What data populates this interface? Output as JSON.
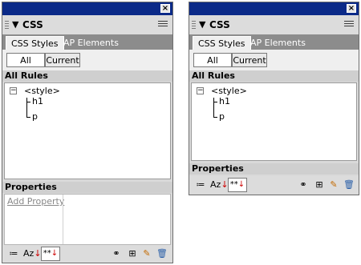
{
  "panels": [
    {
      "title": "CSS",
      "tabs": [
        "CSS Styles",
        "AP Elements"
      ],
      "modes": [
        "All",
        "Current"
      ],
      "rules_label": "All Rules",
      "rules": {
        "root": "<style>",
        "children": [
          "h1",
          "p"
        ]
      },
      "properties_label": "Properties",
      "add_property": "Add Property",
      "toolbar": {
        "az_label": "Az",
        "star_label": "**"
      }
    },
    {
      "title": "CSS",
      "tabs": [
        "CSS Styles",
        "AP Elements"
      ],
      "modes": [
        "All",
        "Current"
      ],
      "rules_label": "All Rules",
      "rules": {
        "root": "<style>",
        "children": [
          "h1",
          "p"
        ]
      },
      "properties_label": "Properties",
      "toolbar": {
        "az_label": "Az",
        "star_label": "**"
      }
    }
  ],
  "icons": [
    "close-icon",
    "gripper-icon",
    "collapse-arrow-icon",
    "options-menu-icon",
    "collapse-tree-icon",
    "category-view-icon",
    "alpha-sort-icon",
    "set-properties-icon",
    "attach-stylesheet-icon",
    "new-rule-icon",
    "edit-rule-icon",
    "delete-rule-icon"
  ],
  "colors": {
    "titlebar": "#0b2a88",
    "panel_bg": "#d9d9d9",
    "tabs_bg": "#8c8c8c",
    "link": "#888888"
  }
}
